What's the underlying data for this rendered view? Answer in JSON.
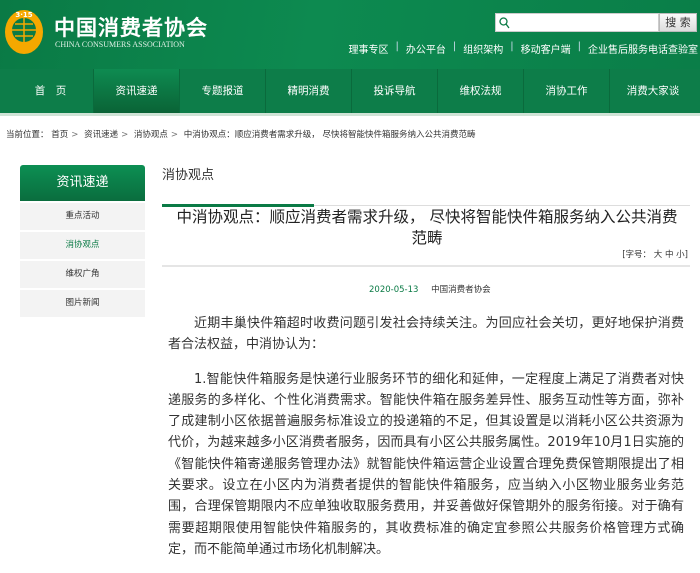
{
  "header": {
    "title": "中国消费者协会",
    "subtitle": "CHINA CONSUMERS ASSOCIATION",
    "logo_text": "3·15",
    "search_placeholder": "",
    "search_button": "搜 索",
    "links": [
      "理事专区",
      "办公平台",
      "组织架构",
      "移动客户端",
      "企业售后服务电话查验室"
    ]
  },
  "nav": [
    "首　页",
    "资讯速递",
    "专题报道",
    "精明消费",
    "投诉导航",
    "维权法规",
    "消协工作",
    "消费大家谈"
  ],
  "breadcrumb": {
    "label": "当前位置：",
    "items": [
      "首页",
      "资讯速递",
      "消协观点",
      "中消协观点：顺应消费者需求升级， 尽快将智能快件箱服务纳入公共消费范畴"
    ]
  },
  "sidebar": {
    "title": "资讯速递",
    "items": [
      "重点活动",
      "消协观点",
      "维权广角",
      "图片新闻"
    ]
  },
  "section_title": "消协观点",
  "article": {
    "title": "中消协观点：顺应消费者需求升级， 尽快将智能快件箱服务纳入公共消费范畴",
    "font_size": {
      "label": "[字号：",
      "large": "大",
      "medium": "中",
      "small": "小",
      "close": "]"
    },
    "date": "2020-05-13",
    "source": "中国消费者协会",
    "paragraphs": [
      "近期丰巢快件箱超时收费问题引发社会持续关注。为回应社会关切，更好地保护消费者合法权益，中消协认为：",
      "1.智能快件箱服务是快递行业服务环节的细化和延伸，一定程度上满足了消费者对快递服务的多样化、个性化消费需求。智能快件箱在服务差异性、服务互动性等方面，弥补了成建制小区依据普遍服务标准设立的投递箱的不足，但其设置是以消耗小区公共资源为代价，为越来越多小区消费者服务，因而具有小区公共服务属性。2019年10月1日实施的《智能快件箱寄递服务管理办法》就智能快件箱运营企业设置合理免费保管期限提出了相关要求。设立在小区内为消费者提供的智能快件箱服务，应当纳入小区物业服务业务范围，合理保管期限内不应单独收取服务费用，并妥善做好保管期外的服务衔接。对于确有需要超期限使用智能快件箱服务的，其收费标准的确定宜参照公共服务价格管理方式确定，而不能简单通过市场化机制解决。"
    ]
  },
  "colors": {
    "brand": "#0a7a45",
    "logo": "#f5a800"
  }
}
